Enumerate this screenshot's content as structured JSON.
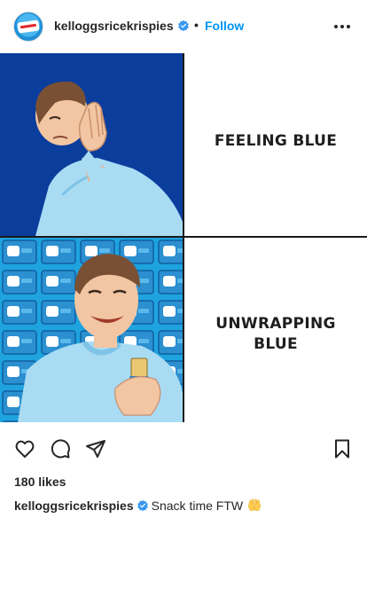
{
  "header": {
    "username": "kelloggsricekrispies",
    "separator": "•",
    "follow_label": "Follow",
    "verified_icon": "verified-badge-icon",
    "more_icon": "more-options-icon"
  },
  "post": {
    "panels": {
      "top_right_text": "FEELING BLUE",
      "bottom_right_line1": "UNWRAPPING",
      "bottom_right_line2": "BLUE"
    },
    "colors": {
      "panel_dark_blue": "#0a3d9c",
      "panel_light_blue": "#1ea3df",
      "follow_blue": "#0095f6",
      "verified_blue": "#3897f0"
    }
  },
  "actions": {
    "like_icon": "heart-icon",
    "comment_icon": "comment-icon",
    "share_icon": "share-icon",
    "save_icon": "bookmark-icon"
  },
  "likes_text": "180 likes",
  "caption": {
    "username": "kelloggsricekrispies",
    "text": "Snack time FTW",
    "emoji": "raising-hands-emoji"
  }
}
